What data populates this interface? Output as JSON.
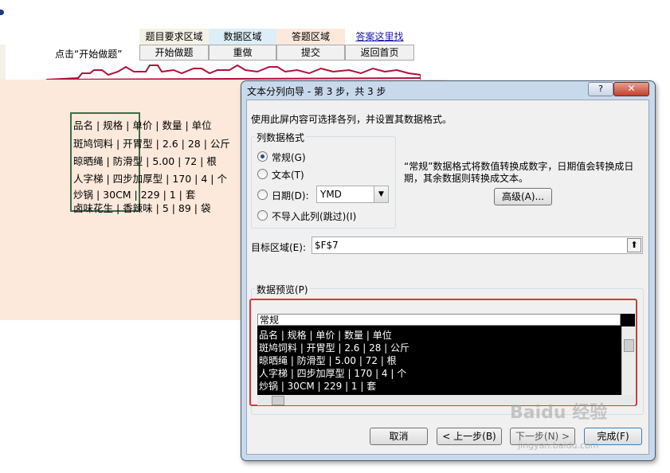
{
  "page": {
    "top_tabs": [
      "题目要求区域",
      "数据区域",
      "答题区域",
      "答案这里找"
    ],
    "buttons": [
      "开始做题",
      "重做",
      "提交",
      "返回首页"
    ],
    "hint": "点击“开始做题”",
    "sheet_lines": [
      "品名 | 规格 | 单价 | 数量 | 单位",
      "斑鸠饲料 | 开胃型 | 2.6 | 28 | 公斤",
      "晾晒绳 | 防滑型 | 5.00 | 72 | 根",
      "人字梯 | 四步加厚型 | 170 | 4 | 个",
      "炒锅 | 30CM | 229 | 1 | 套",
      "卤味花生 | 香辣味 | 5 | 89 | 袋"
    ]
  },
  "dialog": {
    "title": "文本分列向导 - 第 3 步，共 3 步",
    "help_label": "?",
    "close_label": "✕",
    "intro": "使用此屏内容可选择各列，并设置其数据格式。",
    "format_group_label": "列数据格式",
    "radios": [
      {
        "label": "常规(G)",
        "selected": true
      },
      {
        "label": "文本(T)",
        "selected": false
      },
      {
        "label": "日期(D):",
        "selected": false
      },
      {
        "label": "不导入此列(跳过)(I)",
        "selected": false
      }
    ],
    "date_format": "YMD",
    "description_line1": "“常规”数据格式将数值转换成数字，日期值会转换成日",
    "description_line2": "期，其余数据则转换成文本。",
    "advanced_label": "高级(A)...",
    "target_label": "目标区域(E):",
    "target_value": "$F$7",
    "preview_label": "数据预览(P)",
    "preview_header": "常规",
    "preview_lines": [
      "品名 | 规格 | 单价 | 数量 | 单位",
      "斑鸠饲料 | 开胃型 | 2.6 | 28 | 公斤",
      "晾晒绳 | 防滑型 | 5.00 | 72 | 根",
      "人字梯 | 四步加厚型 | 170 | 4 | 个",
      "炒锅 | 30CM | 229 | 1 | 套"
    ],
    "cancel_label": "取消",
    "back_label": "< 上一步(B)",
    "next_label": "下一步(N) >",
    "finish_label": "完成(F)"
  },
  "watermark": {
    "text": "Baidu 经验",
    "url": "jingyan.baidu.com"
  },
  "colors": {
    "peach": "#fde9dc",
    "tab_blue": "#dceef7",
    "red_highlight": "#d23a3a"
  }
}
